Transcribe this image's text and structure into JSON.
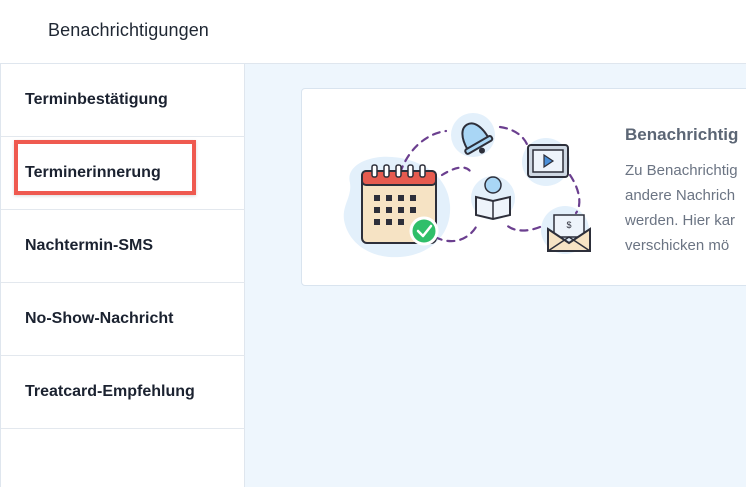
{
  "header": {
    "title": "Benachrichtigungen"
  },
  "sidebar": {
    "items": [
      {
        "label": "Terminbestätigung"
      },
      {
        "label": "Terminerinnerung",
        "highlighted": true
      },
      {
        "label": "Nachtermin-SMS"
      },
      {
        "label": "No-Show-Nachricht"
      },
      {
        "label": "Treatcard-Empfehlung"
      }
    ]
  },
  "card": {
    "title": "Benachrichtig",
    "text_lines": [
      "Zu Benachrichtig",
      "andere Nachrich",
      "werden. Hier kar",
      "verschicken mö"
    ]
  },
  "colors": {
    "highlight": "#ef5a50",
    "main_bg": "#eef6fd",
    "calendar_red": "#e65b4f",
    "check_green": "#2fbf6a"
  },
  "icons": [
    "calendar-icon",
    "check-icon",
    "bell-icon",
    "video-icon",
    "book-icon",
    "envelope-icon"
  ]
}
